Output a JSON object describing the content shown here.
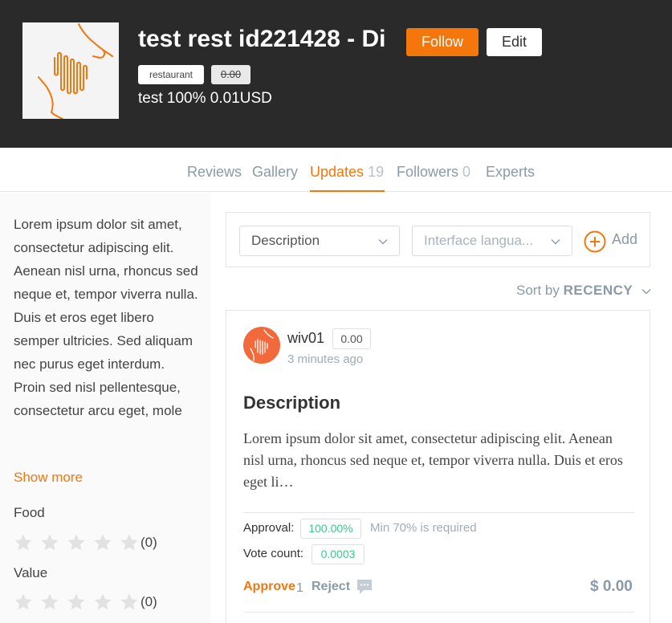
{
  "header": {
    "title": "test rest id221428 - Di",
    "follow_label": "Follow",
    "edit_label": "Edit",
    "tag_type": "restaurant",
    "tag_rating": "0.00",
    "subline": "test 100% 0.01USD"
  },
  "tabs": {
    "reviews": "Reviews",
    "gallery": "Gallery",
    "updates": "Updates",
    "updates_count": "19",
    "followers": "Followers",
    "followers_count": "0",
    "experts": "Experts",
    "active": "Updates"
  },
  "sidebar": {
    "description": "Lorem ipsum dolor sit amet, consectetur adipiscing elit. Aenean nisl urna, rhoncus sed neque et, tempor viverra nulla. Duis et eros eget libero semper ultricies. Sed aliquam nec purus eget interdum. Proin sed nisl pellentesque, consectetur arcu eget, mole",
    "show_more": "Show more",
    "ratings": [
      {
        "label": "Food",
        "count": "(0)",
        "stars": 0
      },
      {
        "label": "Value",
        "count": "(0)",
        "stars": 0
      }
    ]
  },
  "filters": {
    "field_select": "Description",
    "language_placeholder": "Interface langua...",
    "add_label": "Add"
  },
  "sort": {
    "label": "Sort by",
    "value": "RECENCY"
  },
  "update": {
    "author": "wiv01",
    "author_rating": "0.00",
    "time": "3 minutes ago",
    "title": "Description",
    "body": "Lorem ipsum dolor sit amet, consectetur adipiscing elit. Aenean nisl urna, rhoncus sed neque et, tempor viverra nulla. Duis et eros eget li…",
    "approval_label": "Approval:",
    "approval_value": "100.00%",
    "min_note": "Min 70% is required",
    "vote_label": "Vote count:",
    "vote_value": "0.0003",
    "approve_label": "Approve",
    "approve_count": "1",
    "reject_label": "Reject",
    "price": "$ 0.00"
  },
  "colors": {
    "accent": "#f5760a",
    "header_bg": "#2a2a2a",
    "muted": "#8a9aa8",
    "success": "#3cc88c",
    "star_empty": "#e2e2e2"
  }
}
